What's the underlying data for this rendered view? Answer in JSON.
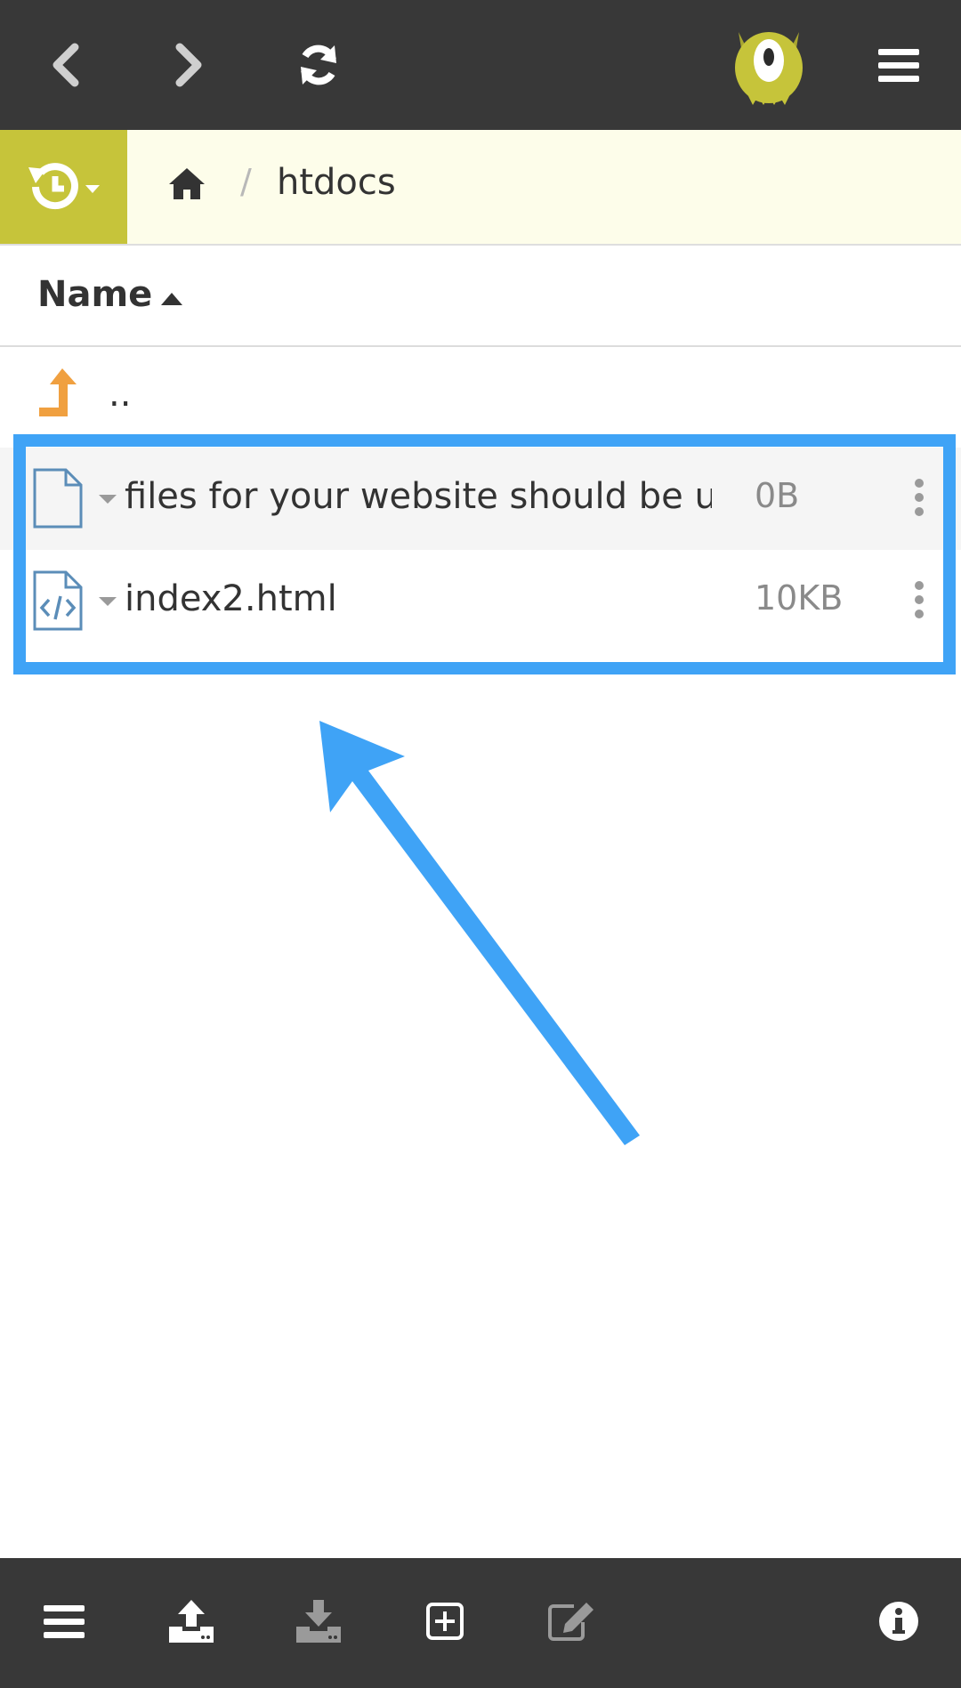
{
  "toolbar": {
    "back_icon": "chevron-left-icon",
    "forward_icon": "chevron-right-icon",
    "refresh_icon": "refresh-icon",
    "logo_icon": "monster-logo",
    "menu_icon": "hamburger-menu-icon"
  },
  "breadcrumb": {
    "history_icon": "history-icon",
    "home_icon": "home-icon",
    "separator": "/",
    "current": "htdocs"
  },
  "list_header": {
    "name_label": "Name",
    "sort_direction": "ascending"
  },
  "parent_dir": {
    "label": ".."
  },
  "files": [
    {
      "name": "files for your website should be u...",
      "size": "0B",
      "icon": "file-icon"
    },
    {
      "name": "index2.html",
      "size": "10KB",
      "icon": "code-file-icon"
    }
  ],
  "bottom_toolbar": {
    "items": [
      "menu-icon",
      "upload-icon",
      "download-icon",
      "new-file-icon",
      "edit-icon",
      "info-icon"
    ]
  },
  "colors": {
    "dark_bar": "#383838",
    "accent_green": "#c6c43a",
    "breadcrumb_bg": "#fdfdea",
    "file_icon_blue": "#5b8db8",
    "parent_orange": "#f0a040",
    "annotation_blue": "#3fa3f6"
  }
}
